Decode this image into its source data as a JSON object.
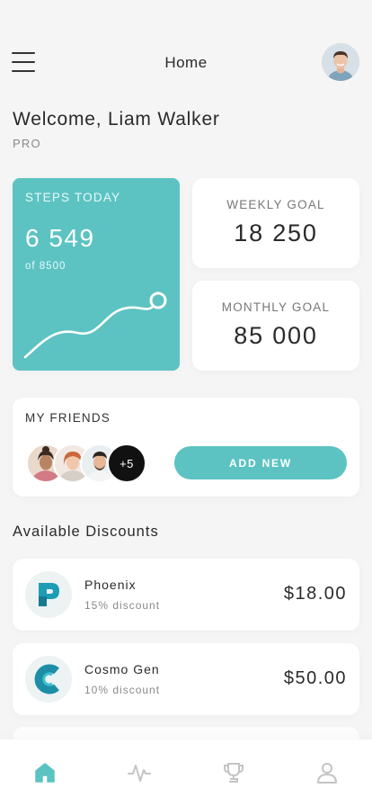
{
  "header": {
    "title": "Home",
    "menu_icon": "hamburger-menu-icon",
    "avatar_icon": "user-avatar"
  },
  "user": {
    "welcome": "Welcome, Liam Walker",
    "tier": "PRO"
  },
  "stats": {
    "steps": {
      "label": "STEPS TODAY",
      "value": "6 549",
      "of": "of 8500",
      "progress_fraction": 0.77
    },
    "weekly": {
      "label": "WEEKLY GOAL",
      "value": "18 250"
    },
    "monthly": {
      "label": "MONTHLY GOAL",
      "value": "85 000"
    }
  },
  "friends": {
    "label": "MY FRIENDS",
    "more": "+5",
    "add_button": "ADD NEW"
  },
  "discounts": {
    "title": "Available Discounts",
    "items": [
      {
        "name": "Phoenix",
        "sub": "15% discount",
        "price": "$18.00",
        "logo": "phoenix-logo"
      },
      {
        "name": "Cosmo Gen",
        "sub": "10% discount",
        "price": "$50.00",
        "logo": "cosmo-gen-logo"
      }
    ]
  },
  "tabs": [
    {
      "icon": "home-icon",
      "active": true
    },
    {
      "icon": "activity-icon",
      "active": false
    },
    {
      "icon": "trophy-icon",
      "active": false
    },
    {
      "icon": "profile-icon",
      "active": false
    }
  ],
  "colors": {
    "accent": "#5cc3c2",
    "background": "#f5f5f5",
    "card": "#ffffff",
    "text": "#2a2a2a",
    "muted": "#8a8a8a",
    "inactive_icon": "#c4c4c4"
  }
}
